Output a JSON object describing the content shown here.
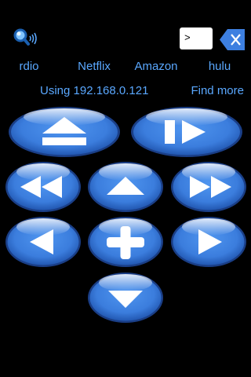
{
  "search": {
    "icon": "magnifier-sound-icon"
  },
  "input": {
    "value": ">"
  },
  "backspace": {
    "icon": "backspace-x-icon"
  },
  "services": [
    {
      "label": "rdio"
    },
    {
      "label": "Netflix"
    },
    {
      "label": "Amazon"
    },
    {
      "label": "hulu"
    }
  ],
  "status": {
    "using": "Using 192.168.0.121",
    "find_more": "Find more"
  },
  "colors": {
    "background": "#000000",
    "accent_text": "#5aa8ff",
    "button_blue": "#3d7fe0",
    "button_highlight": "#bcd8ff",
    "button_glyph": "#ffffff"
  },
  "buttons": [
    {
      "name": "eject-button",
      "icon": "eject-icon"
    },
    {
      "name": "play-pause-button",
      "icon": "play-pause-icon"
    },
    {
      "name": "rewind-button",
      "icon": "rewind-icon"
    },
    {
      "name": "up-button",
      "icon": "up-arrow-icon"
    },
    {
      "name": "fast-forward-button",
      "icon": "fast-forward-icon"
    },
    {
      "name": "left-button",
      "icon": "left-arrow-icon"
    },
    {
      "name": "select-button",
      "icon": "plus-icon"
    },
    {
      "name": "right-button",
      "icon": "right-arrow-icon"
    },
    {
      "name": "down-button",
      "icon": "down-arrow-icon"
    }
  ]
}
